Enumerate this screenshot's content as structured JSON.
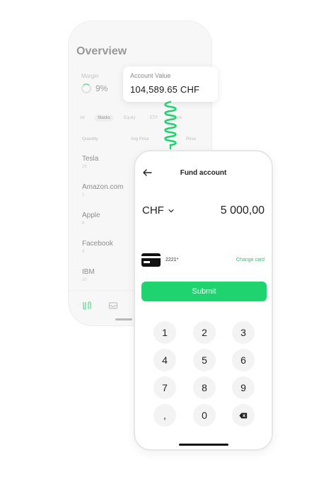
{
  "overview": {
    "title": "Overview",
    "margin_label": "Margin",
    "margin_value": "9%",
    "tabs": [
      "All",
      "Stocks",
      "Equity",
      "ETF",
      "Funds"
    ],
    "columns": [
      "Quantity",
      "Avg Price",
      "Price"
    ],
    "stocks": [
      {
        "name": "Tesla",
        "sub": "25"
      },
      {
        "name": "Amazon.com",
        "sub": "1"
      },
      {
        "name": "Apple",
        "sub": "8"
      },
      {
        "name": "Facebook",
        "sub": "4"
      },
      {
        "name": "IBM",
        "sub": "10"
      }
    ]
  },
  "account_value": {
    "label": "Account Value",
    "value": "104,589.65 CHF"
  },
  "fund_account": {
    "title": "Fund account",
    "currency": "CHF",
    "amount": "5 000,00",
    "card_number": "2221*",
    "change_card": "Change card",
    "submit": "Submit",
    "keypad": [
      "1",
      "2",
      "3",
      "4",
      "5",
      "6",
      "7",
      "8",
      "9",
      ",",
      "0"
    ]
  },
  "colors": {
    "accent": "#1fd36e",
    "accent_text": "#2fc46f"
  }
}
